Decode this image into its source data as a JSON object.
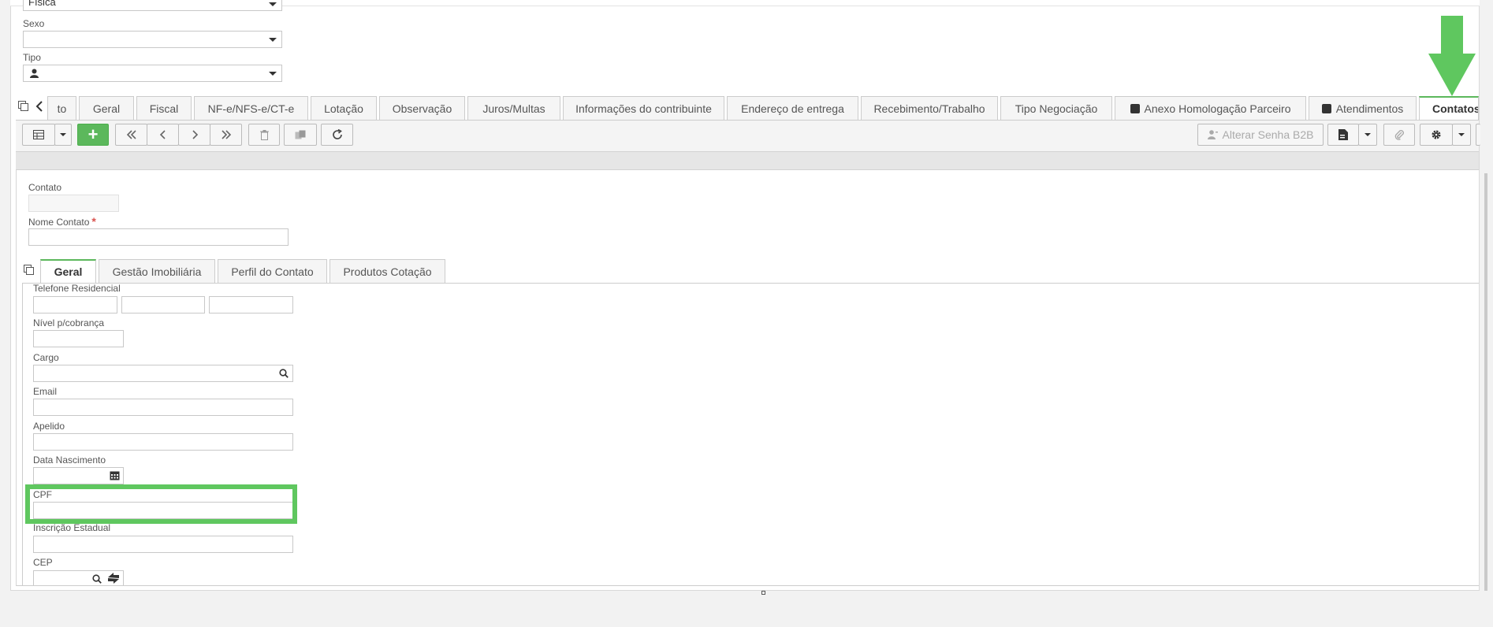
{
  "form": {
    "top_select_value": "Física",
    "sexo_label": "Sexo",
    "sexo_value": "",
    "tipo_label": "Tipo",
    "tipo_icon": "user-icon"
  },
  "tabs": [
    {
      "label": "to"
    },
    {
      "label": "Geral"
    },
    {
      "label": "Fiscal"
    },
    {
      "label": "NF-e/NFS-e/CT-e"
    },
    {
      "label": "Lotação"
    },
    {
      "label": "Observação"
    },
    {
      "label": "Juros/Multas"
    },
    {
      "label": "Informações do contribuinte"
    },
    {
      "label": "Endereço de entrega"
    },
    {
      "label": "Recebimento/Trabalho"
    },
    {
      "label": "Tipo Negociação"
    },
    {
      "label": "Anexo Homologação Parceiro"
    },
    {
      "label": "Atendimentos"
    },
    {
      "label": "Contatos"
    }
  ],
  "toolbar": {
    "add_label": "+",
    "alterar_senha_label": "Alterar Senha B2B"
  },
  "contact": {
    "contato_label": "Contato",
    "contato_value": "",
    "nome_label": "Nome Contato",
    "required_mark": "*",
    "nome_value": ""
  },
  "inner_tabs": [
    {
      "label": "Geral"
    },
    {
      "label": "Gestão Imobiliária"
    },
    {
      "label": "Perfil do Contato"
    },
    {
      "label": "Produtos Cotação"
    }
  ],
  "fields": {
    "telefone_label": "Telefone Residencial",
    "nivel_label": "Nível p/cobrança",
    "cargo_label": "Cargo",
    "email_label": "Email",
    "apelido_label": "Apelido",
    "data_nasc_label": "Data Nascimento",
    "cpf_label": "CPF",
    "inscricao_label": "Inscrição Estadual",
    "cep_label": "CEP"
  },
  "colors": {
    "accent_green": "#5cb85c",
    "highlight_green": "#5fc75f",
    "required_red": "#d9534f"
  }
}
